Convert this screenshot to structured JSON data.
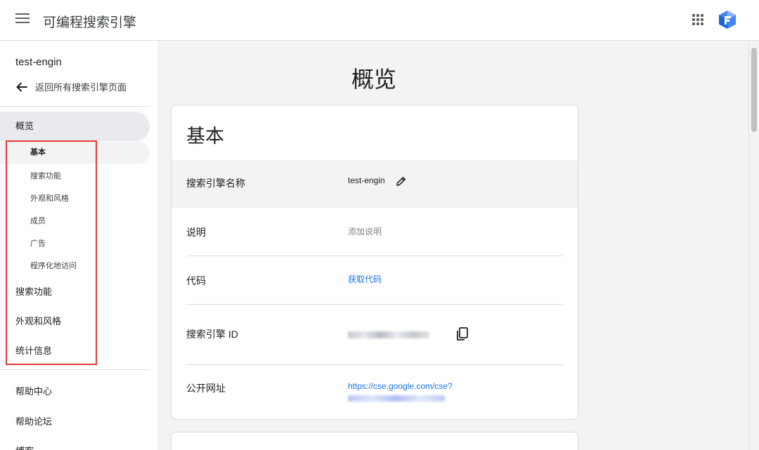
{
  "app": {
    "title": "可编程搜索引擎"
  },
  "sidebar": {
    "engine_name": "test-engin",
    "back_label": "返回所有搜索引擎页面",
    "overview": "概览",
    "sub_items": [
      "基本",
      "搜索功能",
      "外观和风格",
      "成员",
      "广告",
      "程序化地访问"
    ],
    "main_items": [
      "搜索功能",
      "外观和风格",
      "统计信息"
    ],
    "help_items": [
      "帮助中心",
      "帮助论坛",
      "博客"
    ]
  },
  "main": {
    "page_title": "概览",
    "card_title": "基本",
    "rows": {
      "name": {
        "label": "搜索引擎名称",
        "value": "test-engin"
      },
      "description": {
        "label": "说明",
        "placeholder": "添加说明"
      },
      "code": {
        "label": "代码",
        "link": "获取代码"
      },
      "engine_id": {
        "label": "搜索引擎 ID"
      },
      "public_url": {
        "label": "公开网址",
        "url": "https://cse.google.com/cse?"
      }
    }
  },
  "colors": {
    "accent": "#1a73e8",
    "highlight": "#e53935",
    "nav_active": "#e8eaed"
  },
  "icons": [
    "menu-icon",
    "apps-grid-icon",
    "brand-logo",
    "back-arrow-icon",
    "edit-pencil-icon",
    "copy-icon"
  ]
}
